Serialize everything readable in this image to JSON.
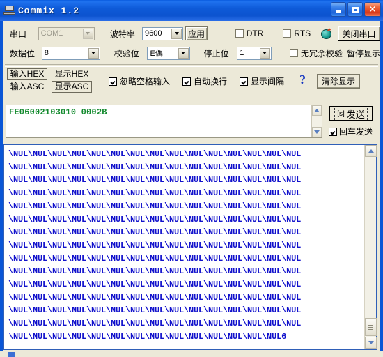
{
  "window": {
    "title": "Commix 1.2",
    "icon": "serial-terminal-icon",
    "minimize": "_",
    "maximize": "□",
    "close": "✕"
  },
  "settings": {
    "port_label": "串口",
    "port_value": "COM1",
    "baud_label": "波特率",
    "baud_value": "9600",
    "apply_label": "应用",
    "dtr_label": "DTR",
    "dtr_checked": false,
    "rts_label": "RTS",
    "rts_checked": false,
    "close_port_label": "关闭串口",
    "databits_label": "数据位",
    "databits_value": "8",
    "parity_label": "校验位",
    "parity_value": "E偶",
    "stopbits_label": "停止位",
    "stopbits_value": "1",
    "no_redundancy_label": "无冗余校验",
    "no_redundancy_checked": false,
    "pause_display_label": "暂停显示"
  },
  "format": {
    "input_hex_label": "输入HEX",
    "input_asc_label": "输入ASC",
    "input_selected": "输入HEX",
    "show_hex_label": "显示HEX",
    "show_asc_label": "显示ASC",
    "show_selected": "显示ASC",
    "ignore_space_label": "忽略空格输入",
    "ignore_space_checked": true,
    "auto_wrap_label": "自动换行",
    "auto_wrap_checked": true,
    "show_interval_label": "显示间隔",
    "show_interval_checked": true,
    "help_label": "?",
    "clear_label": "清除显示"
  },
  "send": {
    "text": "FE06002103010 0002B",
    "button_label": "发送",
    "button_icon": "[s]",
    "enter_send_label": "回车发送"
  },
  "receive": {
    "lines": [
      "\\NUL\\NUL\\NUL\\NUL\\NUL\\NUL\\NUL\\NUL\\NUL\\NUL\\NUL\\NUL\\NUL\\NUL\\NUL",
      "\\NUL\\NUL\\NUL\\NUL\\NUL\\NUL\\NUL\\NUL\\NUL\\NUL\\NUL\\NUL\\NUL\\NUL\\NUL",
      "\\NUL\\NUL\\NUL\\NUL\\NUL\\NUL\\NUL\\NUL\\NUL\\NUL\\NUL\\NUL\\NUL\\NUL\\NUL",
      "\\NUL\\NUL\\NUL\\NUL\\NUL\\NUL\\NUL\\NUL\\NUL\\NUL\\NUL\\NUL\\NUL\\NUL\\NUL",
      "\\NUL\\NUL\\NUL\\NUL\\NUL\\NUL\\NUL\\NUL\\NUL\\NUL\\NUL\\NUL\\NUL\\NUL\\NUL",
      "\\NUL\\NUL\\NUL\\NUL\\NUL\\NUL\\NUL\\NUL\\NUL\\NUL\\NUL\\NUL\\NUL\\NUL\\NUL",
      "\\NUL\\NUL\\NUL\\NUL\\NUL\\NUL\\NUL\\NUL\\NUL\\NUL\\NUL\\NUL\\NUL\\NUL\\NUL",
      "\\NUL\\NUL\\NUL\\NUL\\NUL\\NUL\\NUL\\NUL\\NUL\\NUL\\NUL\\NUL\\NUL\\NUL\\NUL",
      "\\NUL\\NUL\\NUL\\NUL\\NUL\\NUL\\NUL\\NUL\\NUL\\NUL\\NUL\\NUL\\NUL\\NUL\\NUL",
      "\\NUL\\NUL\\NUL\\NUL\\NUL\\NUL\\NUL\\NUL\\NUL\\NUL\\NUL\\NUL\\NUL\\NUL\\NUL",
      "\\NUL\\NUL\\NUL\\NUL\\NUL\\NUL\\NUL\\NUL\\NUL\\NUL\\NUL\\NUL\\NUL\\NUL\\NUL",
      "\\NUL\\NUL\\NUL\\NUL\\NUL\\NUL\\NUL\\NUL\\NUL\\NUL\\NUL\\NUL\\NUL\\NUL\\NUL",
      "\\NUL\\NUL\\NUL\\NUL\\NUL\\NUL\\NUL\\NUL\\NUL\\NUL\\NUL\\NUL\\NUL\\NUL\\NUL",
      "\\NUL\\NUL\\NUL\\NUL\\NUL\\NUL\\NUL\\NUL\\NUL\\NUL\\NUL\\NUL\\NUL\\NUL\\NUL",
      "\\NUL\\NUL\\NUL\\NUL\\NUL\\NUL\\NUL\\NUL\\NUL\\NUL\\NUL\\NUL\\NUL\\NUL6"
    ],
    "scrollbar_position": "near-bottom"
  },
  "colors": {
    "titlebar": "#0c53cf",
    "client": "#ece9d8",
    "send_text": "#138a2e",
    "receive_text": "#1111cc",
    "help": "#0d30c0",
    "recv_border": "#2f5fb8"
  }
}
